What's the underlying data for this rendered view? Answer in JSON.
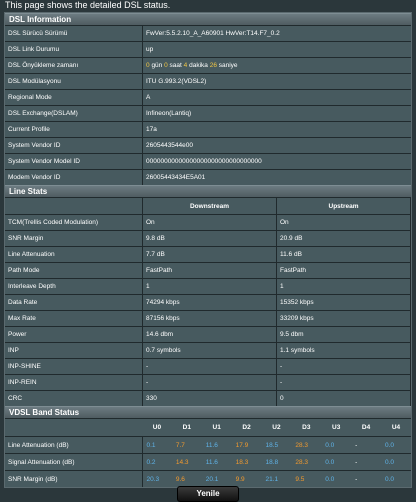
{
  "intro": "This page shows the detailed DSL status.",
  "dsl_info": {
    "title": "DSL Information",
    "rows": [
      {
        "label": "DSL Sürücü Sürümü",
        "value": "FwVer:5.5.2.10_A_A60901 HwVer:T14.F7_0.2"
      },
      {
        "label": "DSL Link Durumu",
        "value": "up"
      },
      {
        "label": "DSL Önyükleme zamanı",
        "uptime": {
          "days": "0",
          "days_unit": "gün",
          "hours": "0",
          "hours_unit": "saat",
          "minutes": "4",
          "minutes_unit": "dakika",
          "seconds": "26",
          "seconds_unit": "saniye"
        }
      },
      {
        "label": "DSL Modülasyonu",
        "value": "ITU G.993.2(VDSL2)"
      },
      {
        "label": "Regional Mode",
        "value": "A"
      },
      {
        "label": "DSL Exchange(DSLAM)",
        "value": "Infineon(Lantiq)"
      },
      {
        "label": "Current Profile",
        "value": "17a"
      },
      {
        "label": "System Vendor ID",
        "value": "2605443544e00"
      },
      {
        "label": "System Vendor Model ID",
        "value": "00000000000000000000000000000000"
      },
      {
        "label": "Modem Vendor ID",
        "value": "26005443434E5A01"
      }
    ]
  },
  "line_stats": {
    "title": "Line Stats",
    "col_downstream": "Downstream",
    "col_upstream": "Upstream",
    "rows": [
      {
        "label": "TCM(Trellis Coded Modulation)",
        "down": "On",
        "up": "On"
      },
      {
        "label": "SNR Margin",
        "down": "9.8 dB",
        "up": "20.9 dB"
      },
      {
        "label": "Line Attenuation",
        "down": "7.7 dB",
        "up": "11.6 dB"
      },
      {
        "label": "Path Mode",
        "down": "FastPath",
        "up": "FastPath"
      },
      {
        "label": "Interleave Depth",
        "down": "1",
        "up": "1"
      },
      {
        "label": "Data Rate",
        "down": "74294 kbps",
        "up": "15352 kbps"
      },
      {
        "label": "Max Rate",
        "down": "87156 kbps",
        "up": "33209 kbps"
      },
      {
        "label": "Power",
        "down": "14.6 dbm",
        "up": "9.5 dbm"
      },
      {
        "label": "INP",
        "down": "0.7 symbols",
        "up": "1.1 symbols"
      },
      {
        "label": "INP-SHINE",
        "down": "-",
        "up": "-"
      },
      {
        "label": "INP-REIN",
        "down": "-",
        "up": "-"
      },
      {
        "label": "CRC",
        "down": "330",
        "up": "0"
      }
    ]
  },
  "band_status": {
    "title": "VDSL Band Status",
    "columns": [
      "U0",
      "D1",
      "U1",
      "D2",
      "U2",
      "D3",
      "U3",
      "D4",
      "U4"
    ],
    "rows": [
      {
        "label": "Line Attenuation (dB)",
        "values": [
          "0.1",
          "7.7",
          "11.6",
          "17.9",
          "18.5",
          "28.3",
          "0.0",
          "-",
          "0.0"
        ]
      },
      {
        "label": "Signal Attenuation (dB)",
        "values": [
          "0.2",
          "14.3",
          "11.6",
          "18.3",
          "18.8",
          "28.3",
          "0.0",
          "-",
          "0.0"
        ]
      },
      {
        "label": "SNR Margin (dB)",
        "values": [
          "20.3",
          "9.6",
          "20.1",
          "9.9",
          "21.1",
          "9.5",
          "0.0",
          "-",
          "0.0"
        ]
      }
    ],
    "colors": {
      "upstream": "#5fb3e8",
      "downstream": "#f29a2e",
      "inactive": "#5fb3e8"
    }
  },
  "refresh_label": "Yenile"
}
